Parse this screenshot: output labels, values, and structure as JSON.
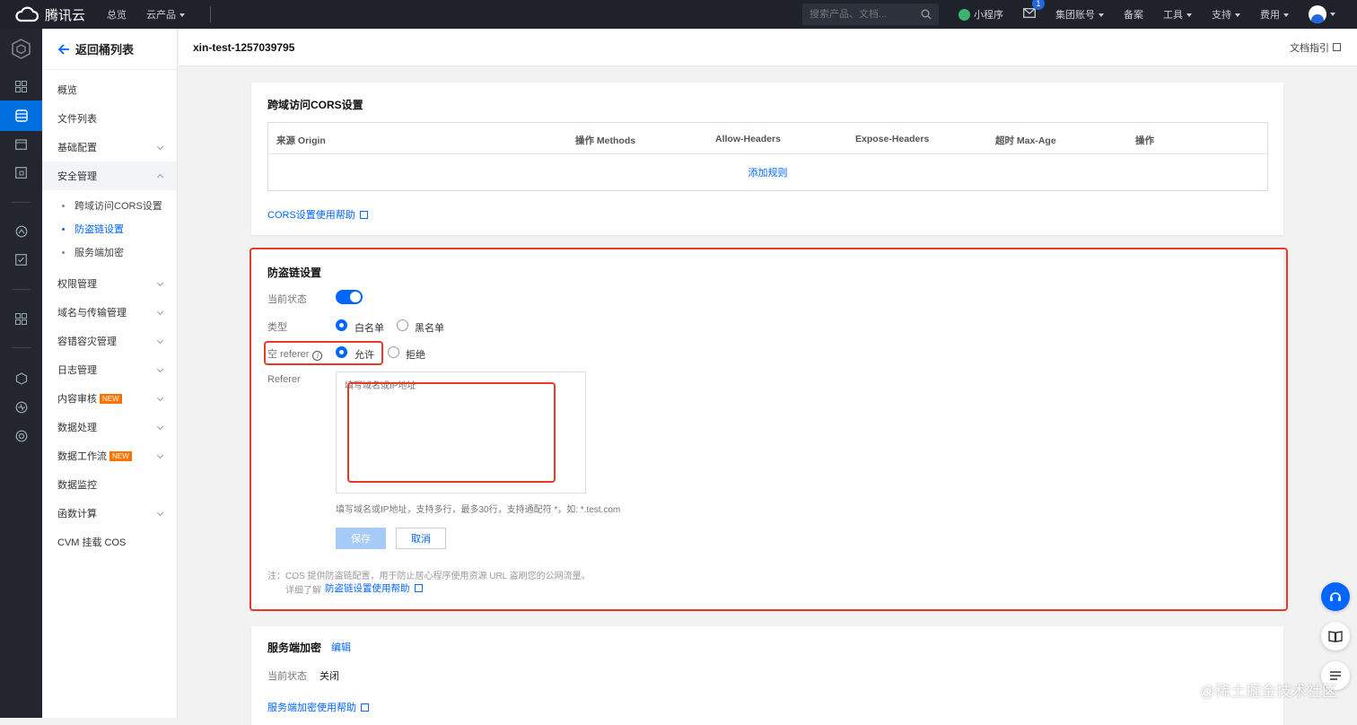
{
  "topbar": {
    "brand": "腾讯云",
    "nav": [
      "总览",
      "云产品"
    ],
    "search_placeholder": "搜索产品、文档...",
    "mini_program": "小程序",
    "mail_badge": "1",
    "group_account": "集团账号",
    "record": "备案",
    "tools": "工具",
    "support": "支持",
    "fees": "费用"
  },
  "sidebar": {
    "back": "返回桶列表",
    "items": [
      "概览",
      "文件列表",
      "基础配置",
      "安全管理"
    ],
    "security_sub": [
      "跨域访问CORS设置",
      "防盗链设置",
      "服务端加密"
    ],
    "items2": [
      "权限管理",
      "域名与传输管理",
      "容错容灾管理",
      "日志管理",
      "内容审核",
      "数据处理",
      "数据工作流",
      "数据监控",
      "函数计算",
      "CVM 挂载 COS"
    ],
    "new_badge": "NEW"
  },
  "header": {
    "bucket_name": "xin-test-1257039795",
    "doc_guide": "文档指引"
  },
  "cors": {
    "title": "跨域访问CORS设置",
    "columns": [
      "来源 Origin",
      "操作 Methods",
      "Allow-Headers",
      "Expose-Headers",
      "超时 Max-Age",
      "操作"
    ],
    "add_rule": "添加规则",
    "help_link": "CORS设置使用帮助"
  },
  "hotlink": {
    "title": "防盗链设置",
    "status_label": "当前状态",
    "status_on": true,
    "type_label": "类型",
    "type_options": [
      "白名单",
      "黑名单"
    ],
    "type_selected": "白名单",
    "empty_referer_label": "空 referer",
    "empty_referer_options": [
      "允许",
      "拒绝"
    ],
    "empty_referer_selected": "允许",
    "referer_label": "Referer",
    "referer_placeholder": "填写域名或IP地址",
    "referer_hint": "填写域名或IP地址，支持多行，最多30行，支持通配符 *，如: *.test.com",
    "save": "保存",
    "cancel": "取消",
    "note": "注：COS 提供防盗链配置，用于防止居心程序使用资源 URL 盗刷您的公网流量。",
    "note_more": "详细了解",
    "note_link": "防盗链设置使用帮助"
  },
  "encryption": {
    "title": "服务端加密",
    "edit": "编辑",
    "status_label": "当前状态",
    "status_value": "关闭",
    "help_link": "服务端加密使用帮助"
  },
  "watermark": "@稀土掘金技术社区",
  "colors": {
    "accent": "#0066ff",
    "highlight": "#e63a2a",
    "topbar": "#1f222b",
    "rail": "#23262f",
    "new_badge": "#ff7200"
  }
}
